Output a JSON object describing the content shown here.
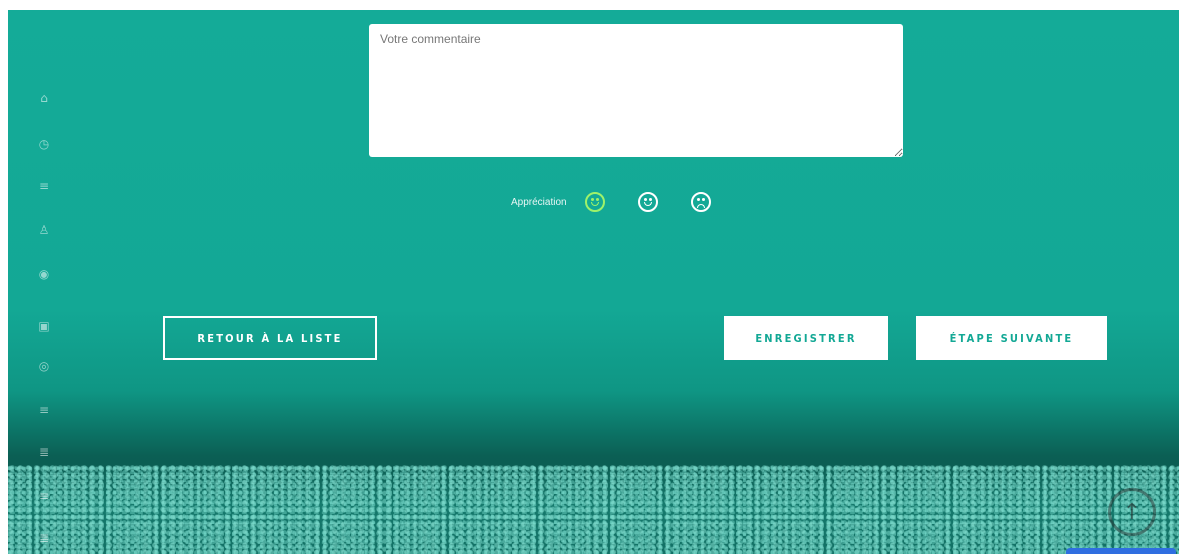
{
  "sidebar": {
    "icons": [
      {
        "name": "home-icon",
        "glyph": "⌂"
      },
      {
        "name": "clock-icon",
        "glyph": "◷"
      },
      {
        "name": "list-icon",
        "glyph": "≡"
      },
      {
        "name": "user-icon",
        "glyph": "♙"
      },
      {
        "name": "eye-icon",
        "glyph": "◉"
      },
      {
        "name": "calendar-icon",
        "glyph": "▣"
      },
      {
        "name": "shield-icon",
        "glyph": "◎"
      },
      {
        "name": "menu-icon",
        "glyph": "≡"
      },
      {
        "name": "document-icon",
        "glyph": "≣"
      },
      {
        "name": "lines-icon",
        "glyph": "≡"
      },
      {
        "name": "settings-icon",
        "glyph": "≣"
      }
    ]
  },
  "form": {
    "comment_placeholder": "Votre commentaire",
    "appreciation_label": "Appréciation",
    "faces": [
      "happy-face-icon",
      "neutral-face-icon",
      "sad-face-icon"
    ]
  },
  "buttons": {
    "back": "RETOUR À LA LISTE",
    "save": "ENREGISTRER",
    "next": "ÉTAPE SUIVANTE"
  },
  "colors": {
    "accent": "#13a895",
    "happy": "#9ef26a",
    "chat": "#2f6ee0"
  },
  "scroll_top_glyph": "↑"
}
